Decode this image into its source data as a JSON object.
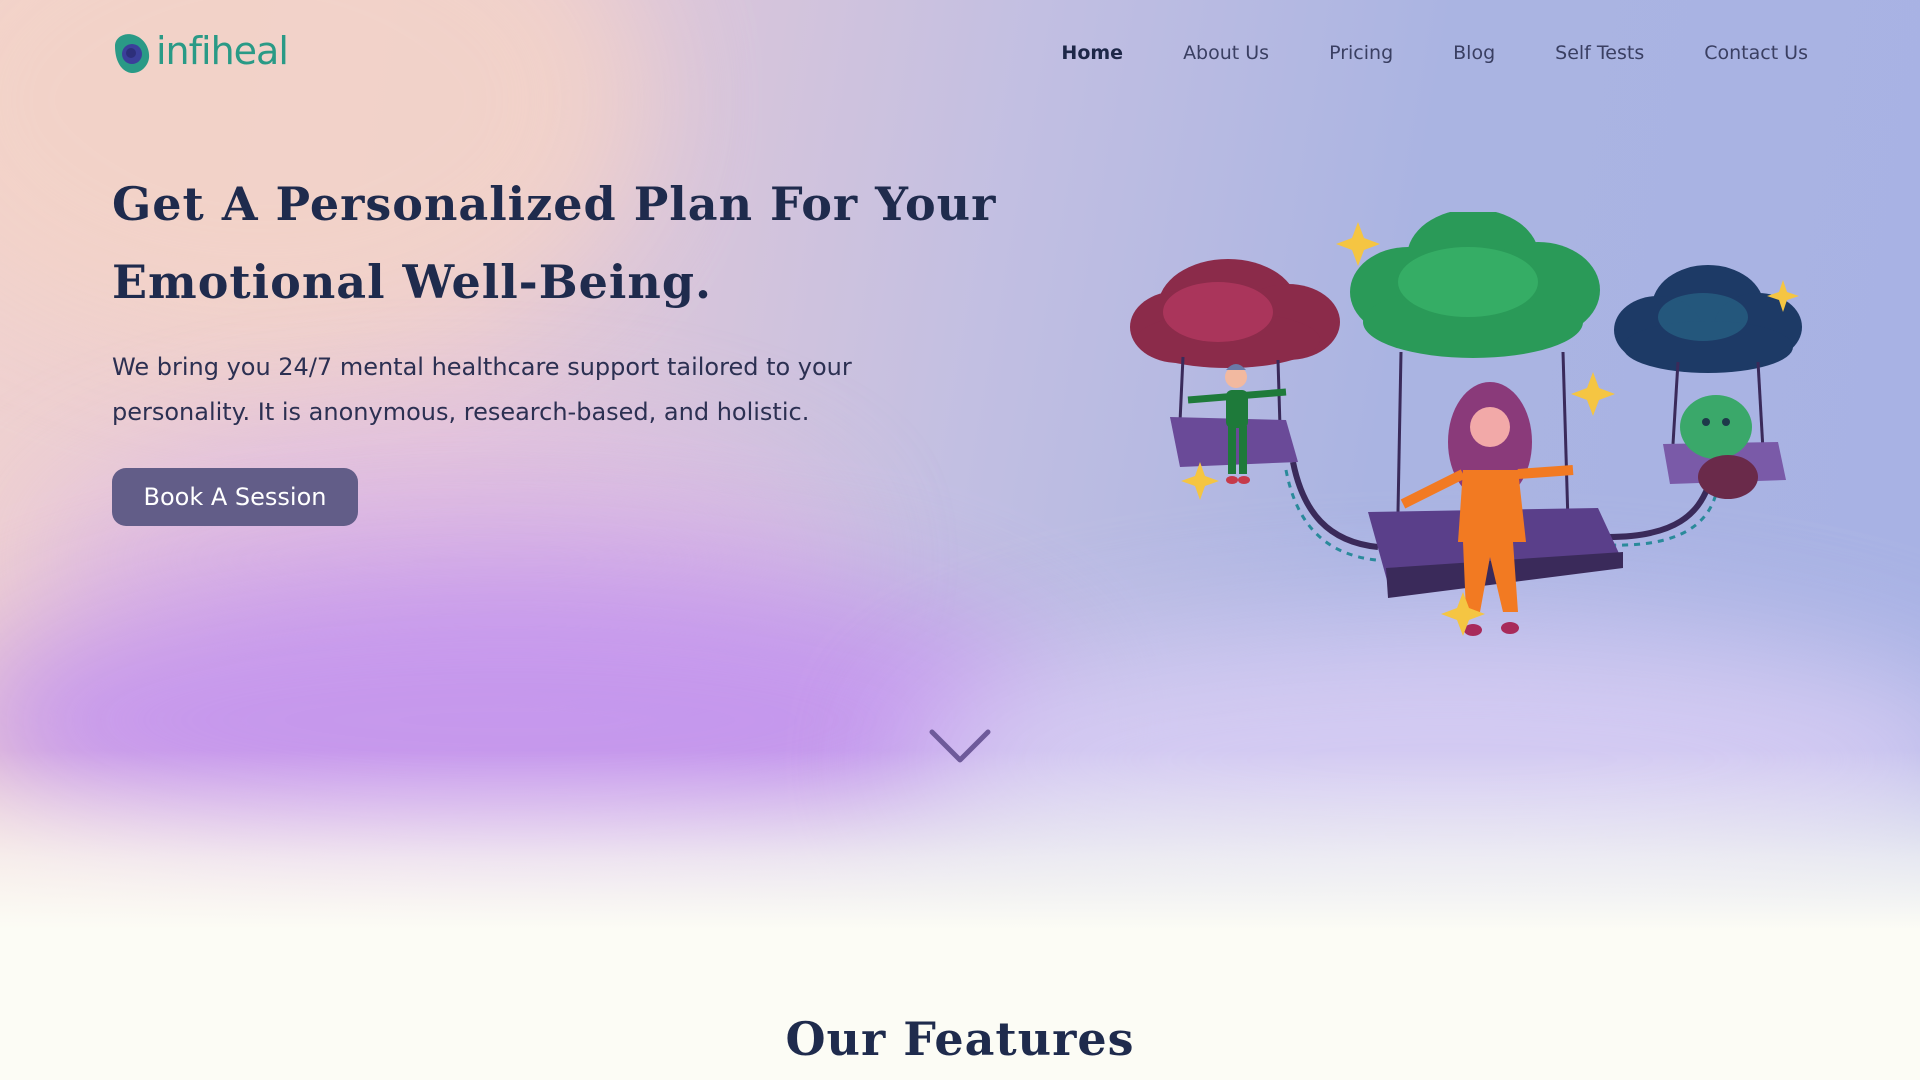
{
  "brand": {
    "name": "infiheal",
    "logo_icon": "leaf-drop-icon",
    "colors": {
      "primary_text": "#1f2b4d",
      "brand_teal": "#2a9a86",
      "button": "#625d88"
    }
  },
  "nav": {
    "items": [
      {
        "label": "Home",
        "active": true
      },
      {
        "label": "About Us"
      },
      {
        "label": "Pricing"
      },
      {
        "label": "Blog"
      },
      {
        "label": "Self Tests"
      },
      {
        "label": "Contact Us"
      }
    ]
  },
  "hero": {
    "title": "Get A Personalized Plan For Your Emotional Well-Being.",
    "subtitle": "We bring you 24/7 mental healthcare support tailored to your personality. It is anonymous, research-based, and holistic.",
    "cta_label": "Book A Session",
    "illustration": "people-on-cloud-swings-illustration",
    "scroll_icon": "chevron-down-icon"
  },
  "features": {
    "title": "Our Features"
  }
}
